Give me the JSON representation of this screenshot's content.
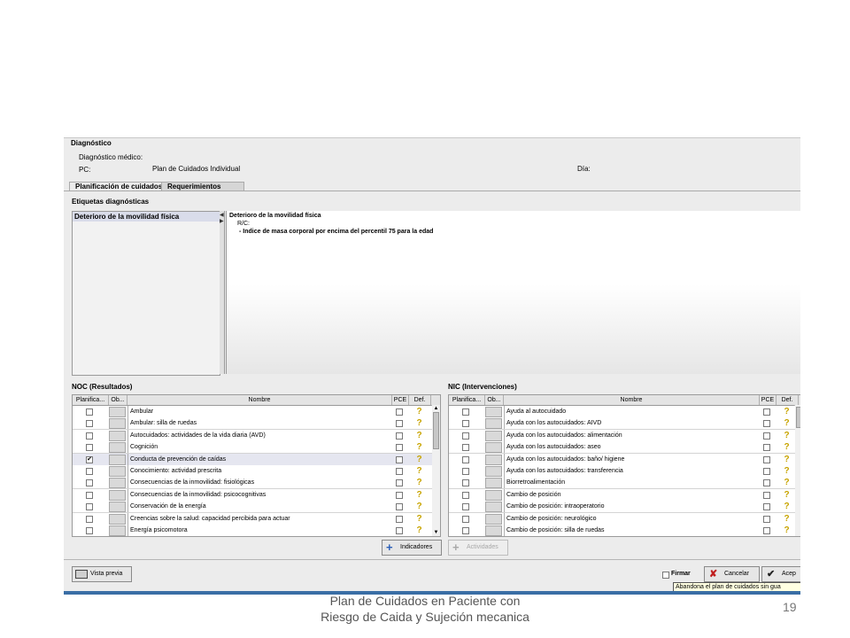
{
  "header": {
    "section_title": "Diagnóstico",
    "medical_label": "Diagnóstico médico:",
    "pc_label": "PC:",
    "pc_value": "Plan de Cuidados Individual",
    "day_label": "Día:"
  },
  "tabs": [
    {
      "label": "Planificación de cuidados"
    },
    {
      "label": "Requerimientos"
    }
  ],
  "labels_section": {
    "title": "Etiquetas diagnósticas",
    "list": [
      "Deterioro de la movilidad física"
    ],
    "detail": {
      "title": "Deterioro de la movilidad física",
      "rc": "R/C:",
      "item": "- Indice de masa corporal por encima del percentil 75 para la edad"
    }
  },
  "noc": {
    "title": "NOC (Resultados)",
    "columns": [
      "Planifica...",
      "Ob...",
      "Nombre",
      "PCE",
      "Def."
    ],
    "rows": [
      {
        "name": "Ambular",
        "checked": false
      },
      {
        "name": "Ambular: silla de ruedas",
        "checked": false
      },
      {
        "name": "Autocuidados: actividades de la vida diaria (AVD)",
        "checked": false
      },
      {
        "name": "Cognición",
        "checked": false
      },
      {
        "name": "Conducta de prevención de caídas",
        "checked": true
      },
      {
        "name": "Conocimiento: actividad prescrita",
        "checked": false
      },
      {
        "name": "Consecuencias de la inmovilidad: fisiológicas",
        "checked": false
      },
      {
        "name": "Consecuencias de la inmovilidad: psicocognitivas",
        "checked": false
      },
      {
        "name": "Conservación de la energía",
        "checked": false
      },
      {
        "name": "Creencias sobre la salud: capacidad percibida para actuar",
        "checked": false
      },
      {
        "name": "Energía psicomotora",
        "checked": false
      }
    ],
    "button_label": "Indicadores"
  },
  "nic": {
    "title": "NIC (Intervenciones)",
    "columns": [
      "Planifica...",
      "Ob...",
      "Nombre",
      "PCE",
      "Def."
    ],
    "rows": [
      {
        "name": "Ayuda al autocuidado"
      },
      {
        "name": "Ayuda con los autocuidados: AIVD"
      },
      {
        "name": "Ayuda con los autocuidados: alimentación"
      },
      {
        "name": "Ayuda con los autocuidados: aseo"
      },
      {
        "name": "Ayuda con los autocuidados: baño/ higiene"
      },
      {
        "name": "Ayuda con los autocuidados: transferencia"
      },
      {
        "name": "Biorretroalimentación"
      },
      {
        "name": "Cambio de posición"
      },
      {
        "name": "Cambio de posición: intraoperatorio"
      },
      {
        "name": "Cambio de posición: neurológico"
      },
      {
        "name": "Cambio de posición: silla de ruedas"
      }
    ],
    "button_label": "Actividades"
  },
  "bottom": {
    "preview_label": "Vista previa",
    "sign_label": "Firmar",
    "cancel_label": "Cancelar",
    "accept_label": "Acep",
    "tooltip": "Abandona el plan de cuidados sin gua"
  },
  "slide": {
    "caption_line1": "Plan de Cuidados en Paciente con",
    "caption_line2": "Riesgo de Caida y Sujeción mecanica",
    "page_number": "19"
  },
  "colors": {
    "help_icon": "#c8a400",
    "highlight_row": "#e5e6f0",
    "tooltip_bg": "#ffffe1"
  }
}
